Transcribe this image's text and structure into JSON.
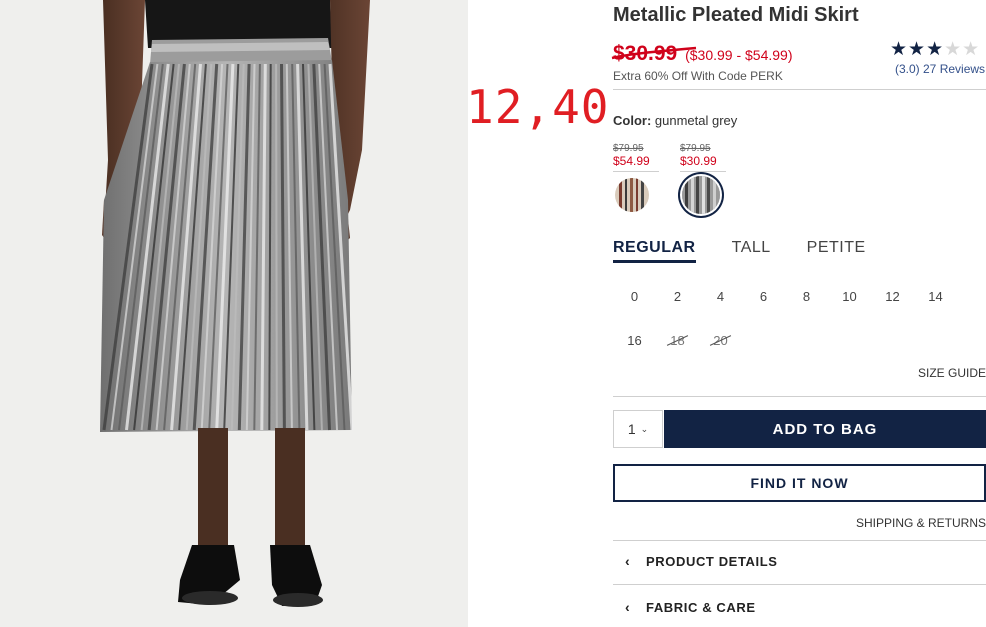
{
  "product": {
    "title": "Metallic Pleated Midi Skirt",
    "price_original": "$30.99",
    "price_range": "($30.99 - $54.99)",
    "promo": "Extra 60% Off With Code PERK",
    "rating": {
      "stars_filled": 3,
      "stars_total": 5,
      "text": "(3.0) 27 Reviews"
    }
  },
  "annotation": {
    "text": "12,40",
    "color": "#e01e23"
  },
  "color": {
    "label": "Color:",
    "value": "gunmetal grey",
    "swatches": [
      {
        "name": "striped",
        "was": "$79.95",
        "now": "$54.99",
        "selected": false
      },
      {
        "name": "gunmetal grey",
        "was": "$79.95",
        "now": "$30.99",
        "selected": true
      }
    ]
  },
  "fit": {
    "tabs": [
      {
        "label": "REGULAR",
        "active": true
      },
      {
        "label": "TALL",
        "active": false
      },
      {
        "label": "PETITE",
        "active": false
      }
    ]
  },
  "sizes": [
    {
      "label": "0",
      "available": true
    },
    {
      "label": "2",
      "available": true
    },
    {
      "label": "4",
      "available": true
    },
    {
      "label": "6",
      "available": true
    },
    {
      "label": "8",
      "available": true
    },
    {
      "label": "10",
      "available": true
    },
    {
      "label": "12",
      "available": true
    },
    {
      "label": "14",
      "available": true
    },
    {
      "label": "16",
      "available": true
    },
    {
      "label": "18",
      "available": false
    },
    {
      "label": "20",
      "available": false
    }
  ],
  "links": {
    "size_guide": "SIZE GUIDE",
    "shipping": "SHIPPING & RETURNS"
  },
  "cart": {
    "quantity": "1",
    "add_label": "ADD TO BAG",
    "find_label": "FIND IT NOW"
  },
  "accordions": [
    {
      "label": "PRODUCT DETAILS"
    },
    {
      "label": "FABRIC & CARE"
    }
  ],
  "colors": {
    "navy": "#122344",
    "sale_red": "#d0021b",
    "divider": "#cfcfcf"
  }
}
